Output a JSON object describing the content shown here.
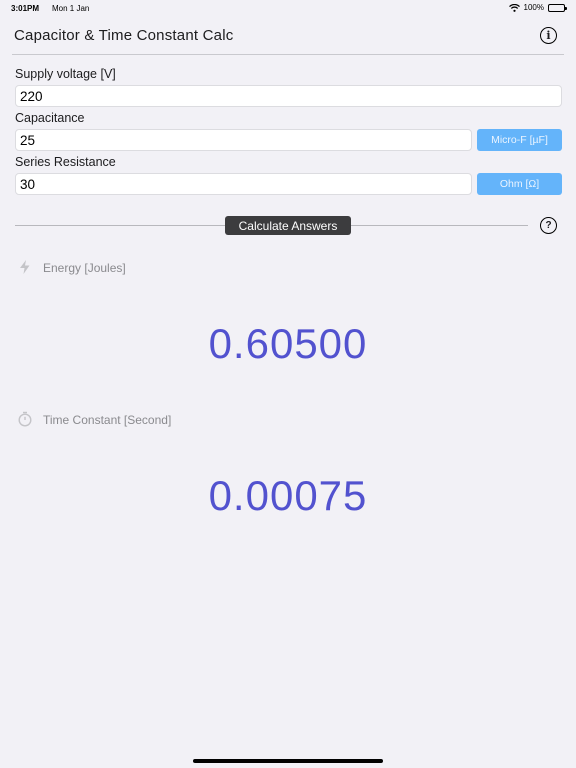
{
  "status_bar": {
    "time": "3:01PM",
    "date": "Mon 1 Jan",
    "battery": "100%"
  },
  "nav": {
    "title": "Capacitor & Time Constant Calc",
    "info_icon": "info-circle-icon"
  },
  "inputs": {
    "supply_voltage": {
      "label": "Supply voltage [V]",
      "value": "220"
    },
    "capacitance": {
      "label": "Capacitance",
      "value": "25",
      "unit": "Micro-F [µF]"
    },
    "resistance": {
      "label": "Series Resistance",
      "value": "30",
      "unit": "Ohm [Ω]"
    }
  },
  "actions": {
    "calculate_label": "Calculate Answers",
    "help_icon": "question-circle-icon"
  },
  "results": {
    "energy": {
      "label": "Energy [Joules]",
      "value": "0.60500",
      "icon": "bolt-icon"
    },
    "time_constant": {
      "label": "Time Constant [Second]",
      "value": "0.00075",
      "icon": "stopwatch-icon"
    }
  },
  "colors": {
    "accent": "#5252cf",
    "unit_button": "#64b4fa",
    "background": "#f2f1f6"
  }
}
